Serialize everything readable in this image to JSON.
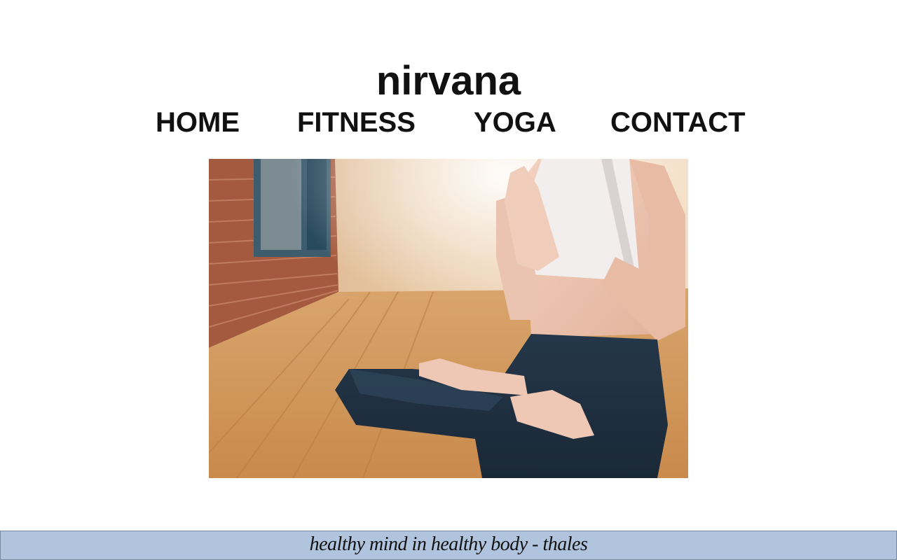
{
  "site": {
    "title": "nirvana"
  },
  "nav": {
    "items": [
      {
        "label": "HOME"
      },
      {
        "label": "FITNESS"
      },
      {
        "label": "YOGA"
      },
      {
        "label": "CONTACT"
      }
    ]
  },
  "hero": {
    "image": "yoga-meditation-photo"
  },
  "footer": {
    "quote": "healthy mind in healthy body - thales"
  },
  "colors": {
    "footer_bg": "#b0c4de",
    "text": "#111111"
  }
}
